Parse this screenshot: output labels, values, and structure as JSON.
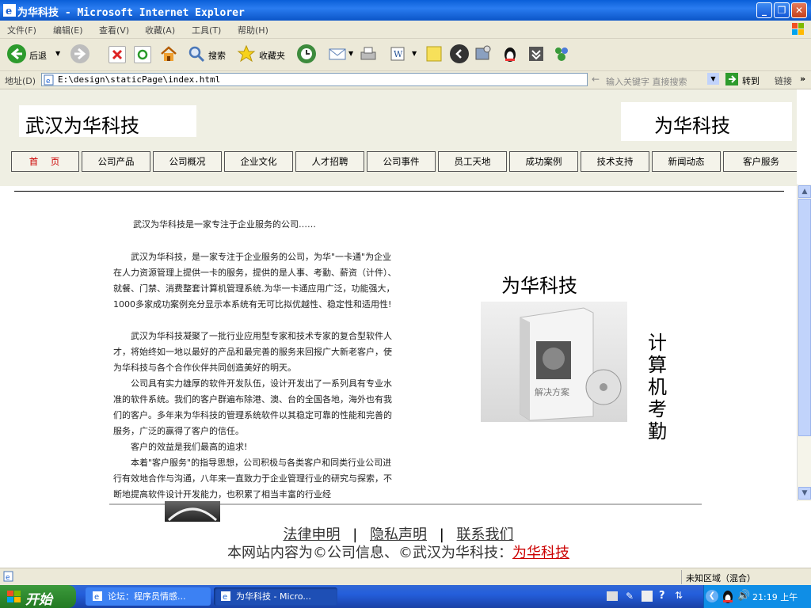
{
  "window": {
    "title": "为华科技 - Microsoft Internet Explorer",
    "controls": [
      "minimize",
      "maximize",
      "close"
    ]
  },
  "menubar": {
    "items": [
      "文件(F)",
      "编辑(E)",
      "查看(V)",
      "收藏(A)",
      "工具(T)",
      "帮助(H)"
    ]
  },
  "toolbar": {
    "back_label": "后退",
    "search_label": "搜索",
    "favorites_label": "收藏夹"
  },
  "addressbar": {
    "label": "地址(D)",
    "url": "E:\\design\\staticPage\\index.html",
    "search_placeholder": "输入关键字  直接搜索",
    "go_label": "转到",
    "links_label": "链接"
  },
  "page": {
    "logo_left": "武汉为华科技",
    "logo_right": "为华科技",
    "nav": [
      "首　页",
      "公司产品",
      "公司概况",
      "企业文化",
      "人才招聘",
      "公司事件",
      "员工天地",
      "成功案例",
      "技术支持",
      "新闻动态",
      "客户服务"
    ],
    "intro_title": "武汉为华科技是一家专注于企业服务的公司……",
    "paragraphs": [
      "　　武汉为华科技，是一家专注于企业服务的公司，为华\"一卡通\"为企业在人力资源管理上提供一卡的服务，提供的是人事、考勤、薪资（计件）、就餐、门禁、消费整套计算机管理系统.为华一卡通应用广泛，功能强大，1000多家成功案例充分显示本系统有无可比拟优越性、稳定性和适用性!",
      "　　武汉为华科技凝聚了一批行业应用型专家和技术专家的复合型软件人才，将始终如一地以最好的产品和最完善的服务来回报广大新老客户，使为华科技与各个合作伙伴共同创造美好的明天。",
      "　　公司具有实力雄厚的软件开发队伍，设计开发出了一系列具有专业水准的软件系统。我们的客户群遍布除港、澳、台的全国各地，海外也有我们的客户。多年来为华科技的管理系统软件以其稳定可靠的性能和完善的服务，广泛的赢得了客户的信任。",
      "　　客户的效益是我们最高的追求!",
      "　　本着\"客户服务\"的指导思想，公司积极与各类客户和同类行业公司进行有效地合作与沟通，八年来一直致力于企业管理行业的研究与探索，不断地提高软件设计开发能力，也积累了相当丰富的行业经"
    ],
    "product_title": "为华科技",
    "product_box_text": "解决方案",
    "vertical_text": "计算机考勤",
    "footer_links": [
      "法律申明",
      "隐私声明",
      "联系我们"
    ],
    "footer_separator": "|",
    "footer_copy": "本网站内容为©公司信息、©武汉为华科技：",
    "footer_copy_link": "为华科技"
  },
  "statusbar": {
    "zone": "未知区域（混合）"
  },
  "taskbar": {
    "start_label": "开始",
    "tasks": [
      "论坛：程序员情感...",
      "为华科技 - Micro..."
    ],
    "clock": "21:19 上午"
  }
}
